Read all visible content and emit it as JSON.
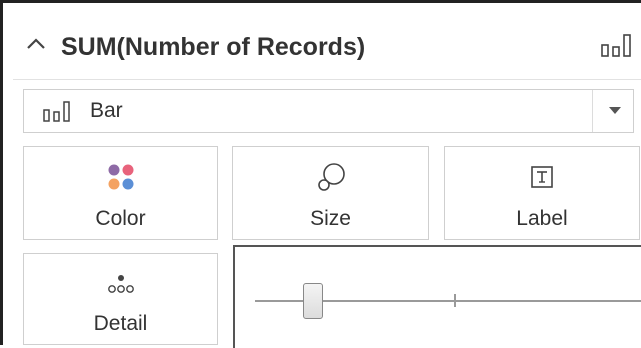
{
  "header": {
    "title": "SUM(Number of Records)",
    "collapse_icon": "chevron-up-icon",
    "mark_icon": "bar-chart-icon"
  },
  "mark_type": {
    "selected": "Bar",
    "icon": "bar-chart-icon",
    "caret_icon": "caret-down-icon"
  },
  "cards": {
    "color": {
      "label": "Color",
      "icon": "color-dots-icon"
    },
    "size": {
      "label": "Size",
      "icon": "size-shapes-icon"
    },
    "label": {
      "label": "Label",
      "icon": "text-label-icon"
    },
    "detail": {
      "label": "Detail",
      "icon": "detail-dots-icon"
    }
  },
  "size_slider": {
    "value_fraction": 0.12
  },
  "colors": {
    "dot_purple": "#8e6aa6",
    "dot_pink": "#e8637c",
    "dot_orange": "#f4a261",
    "dot_blue": "#5b8fd6",
    "text": "#333333",
    "border": "#cfcfcf"
  }
}
